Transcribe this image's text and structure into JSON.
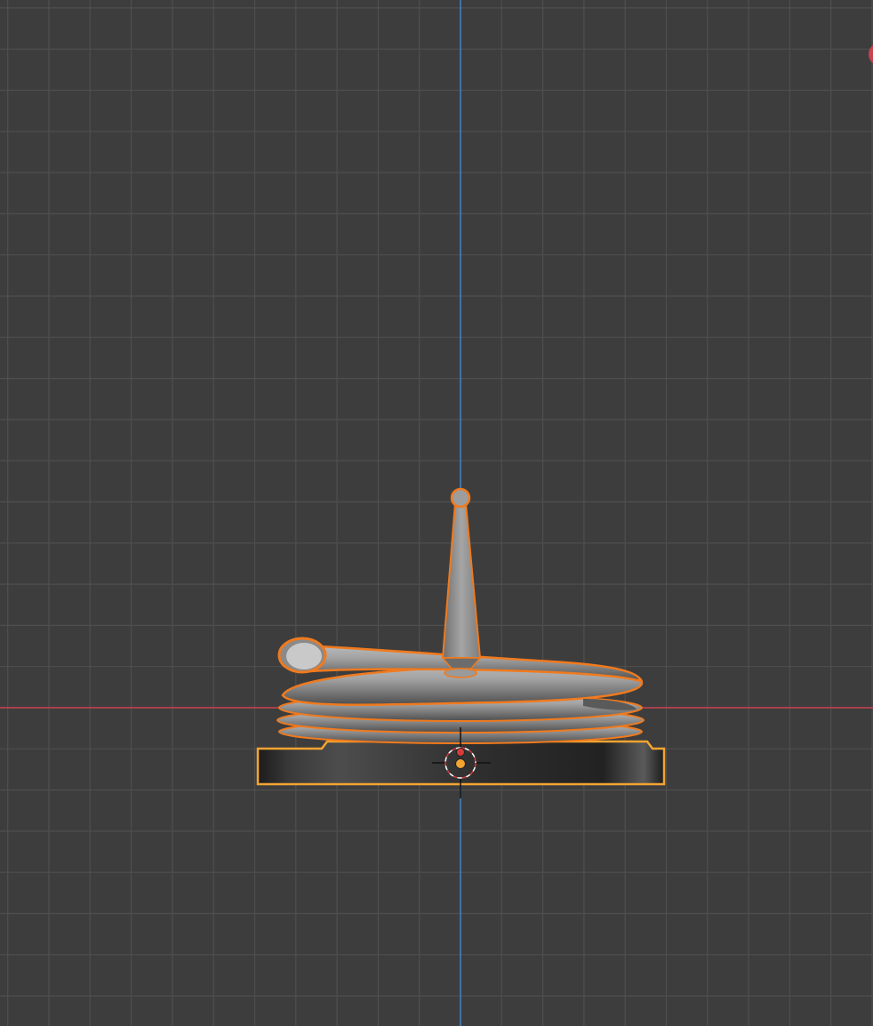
{
  "viewport": {
    "background_color": "#3d3d3d",
    "grid_color": "#4f4f4f",
    "x_axis_color": "#c8424f",
    "z_axis_color": "#3f86c6",
    "selection_outline_color": "#f07a1e",
    "active_outline_color": "#f4a431",
    "mesh_color": "#8f8f8f",
    "base_color": "#2a2a2a",
    "origin_color": "#f4a431",
    "cursor_ring_colors": [
      "#d63b3b",
      "#ffffff"
    ]
  },
  "scene": {
    "objects": [
      {
        "name": "coil",
        "shape": "helix-tube",
        "selected": true
      },
      {
        "name": "spike",
        "shape": "cone",
        "selected": true
      },
      {
        "name": "base",
        "shape": "cylinder-disc",
        "selected": true,
        "active": true
      }
    ],
    "icons": {
      "gizmo": "view-gizmo-x-axis-icon",
      "cursor": "3d-cursor-icon",
      "origin": "object-origin-icon"
    }
  }
}
